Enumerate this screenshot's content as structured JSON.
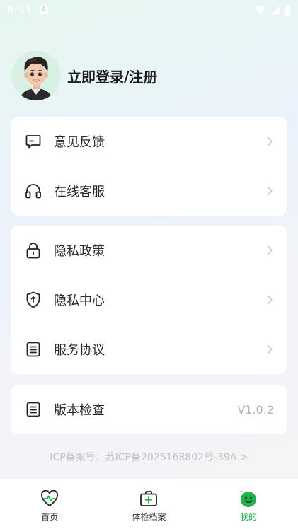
{
  "status_bar": {
    "time": "9:11"
  },
  "profile": {
    "login_text": "立即登录/注册"
  },
  "menu_group_1": [
    {
      "label": "意见反馈",
      "icon": "feedback-icon"
    },
    {
      "label": "在线客服",
      "icon": "headset-icon"
    }
  ],
  "menu_group_2": [
    {
      "label": "隐私政策",
      "icon": "lock-icon"
    },
    {
      "label": "隐私中心",
      "icon": "shield-icon"
    },
    {
      "label": "服务协议",
      "icon": "document-icon"
    }
  ],
  "menu_group_3": [
    {
      "label": "版本检查",
      "icon": "document-icon",
      "value": "V1.0.2"
    }
  ],
  "footer": {
    "icp": "ICP备案号：苏ICP备2025168802号-39A >"
  },
  "tabbar": {
    "items": [
      {
        "label": "首页",
        "icon": "heart-pulse-icon",
        "active": false
      },
      {
        "label": "体检档案",
        "icon": "medical-kit-icon",
        "active": false
      },
      {
        "label": "我的",
        "icon": "smiley-icon",
        "active": true
      }
    ]
  },
  "colors": {
    "accent": "#22b14c",
    "chevron": "#c8c8c8",
    "muted": "#b3b3b3"
  }
}
